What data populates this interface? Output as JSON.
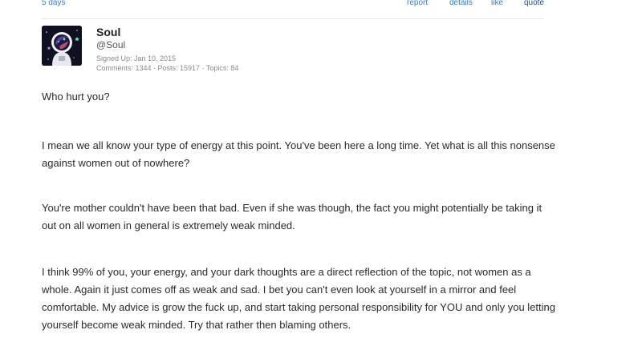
{
  "post_meta": {
    "age": "5 days",
    "actions": {
      "report": "report",
      "details": "details",
      "like": "like",
      "quote": "quote"
    }
  },
  "author": {
    "name": "Soul",
    "handle": "@Soul",
    "signed_up": "Signed Up: Jan 10, 2015",
    "stats": "Comments: 1344 · Posts: 15917 · Topics: 84",
    "avatar_icon": "astronaut-avatar-icon"
  },
  "body": {
    "paragraphs": [
      "Who hurt you?",
      "I mean we all know your type of energy at this point. You've been here a long time. Yet what is all this nonsense against women out of nowhere?",
      "You're mother couldn't have been that bad. Even if she was though, the fact you might potentially be taking it out on all women in general is extremely weak minded.",
      "I think 99% of you, your energy, and your dark thoughts are a direct reflection of the topic, not women as a whole. Again it just comes off as weak and sad. I bet you can't even look at yourself in a mirror and feel comfortable. My advice is grow the fuck up, and start taking personal responsibility for YOU and only you letting yourself become weak minded. Try that rather then blaming others."
    ]
  },
  "colors": {
    "link": "#3d7bc7",
    "text": "#2a2a2a",
    "muted": "#8a8a8a"
  }
}
